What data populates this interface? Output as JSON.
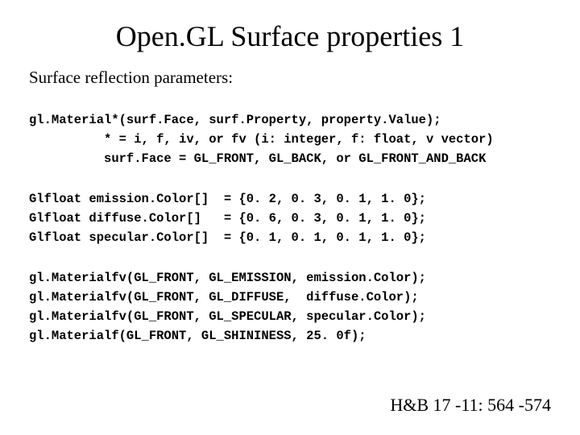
{
  "title": "Open.GL Surface properties 1",
  "subtitle": "Surface reflection parameters:",
  "code_block1": "gl.Material*(surf.Face, surf.Property, property.Value);\n          * = i, f, iv, or fv (i: integer, f: float, v vector)\n          surf.Face = GL_FRONT, GL_BACK, or GL_FRONT_AND_BACK",
  "code_block2": "Glfloat emission.Color[]  = {0. 2, 0. 3, 0. 1, 1. 0};\nGlfloat diffuse.Color[]   = {0. 6, 0. 3, 0. 1, 1. 0};\nGlfloat specular.Color[]  = {0. 1, 0. 1, 0. 1, 1. 0};",
  "code_block3": "gl.Materialfv(GL_FRONT, GL_EMISSION, emission.Color);\ngl.Materialfv(GL_FRONT, GL_DIFFUSE,  diffuse.Color);\ngl.Materialfv(GL_FRONT, GL_SPECULAR, specular.Color);\ngl.Materialf(GL_FRONT, GL_SHININESS, 25. 0f);",
  "footer": "H&B 17 -11: 564 -574"
}
